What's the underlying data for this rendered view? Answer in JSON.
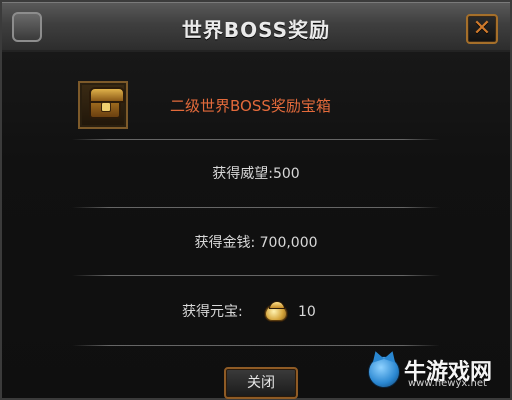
{
  "window": {
    "title": "世界BOSS奖励",
    "close_glyph": "✕",
    "colors": {
      "frame": "#3b3b3b",
      "title_text": "#eaeaea",
      "item_name": "#e36a3b",
      "close_accent": "#d07a2c"
    }
  },
  "reward": {
    "item_name": "二级世界BOSS奖励宝箱",
    "prestige_text": "获得威望:500",
    "money_text": "获得金钱: 700,000",
    "yuanbao_label": "获得元宝:",
    "yuanbao_value": "10"
  },
  "footer": {
    "close_button_label": "关闭"
  },
  "watermark": {
    "brand": "牛游戏网",
    "url": "www.newyx.net",
    "icon": "cow-mascot-icon"
  }
}
